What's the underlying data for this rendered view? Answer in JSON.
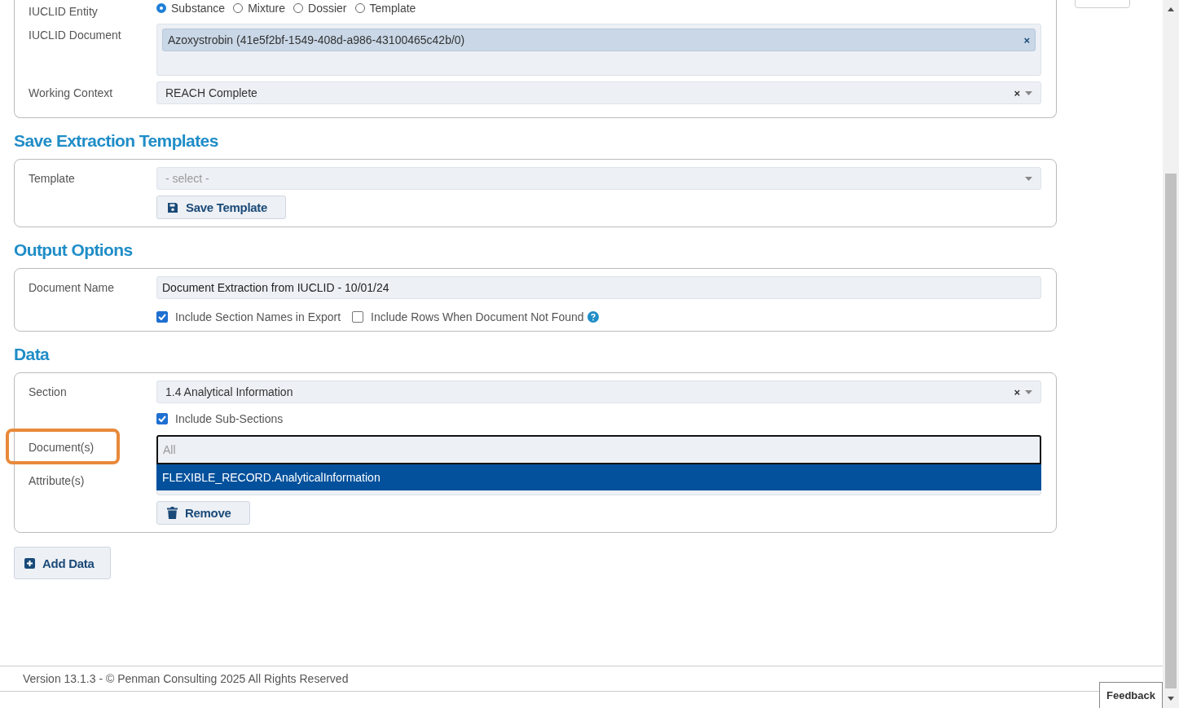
{
  "entity": {
    "label": "IUCLID Entity",
    "options": [
      {
        "label": "Substance",
        "selected": true
      },
      {
        "label": "Mixture",
        "selected": false
      },
      {
        "label": "Dossier",
        "selected": false
      },
      {
        "label": "Template",
        "selected": false
      }
    ]
  },
  "document": {
    "label": "IUCLID Document",
    "tags": [
      {
        "text": "Azoxystrobin (41e5f2bf-1549-408d-a986-43100465c42b/0)",
        "remove": "×"
      }
    ]
  },
  "working_context": {
    "label": "Working Context",
    "value": "REACH Complete",
    "clear": "×"
  },
  "templates": {
    "heading": "Save Extraction Templates",
    "label": "Template",
    "placeholder": "- select -",
    "button": "Save Template"
  },
  "output": {
    "heading": "Output Options",
    "name_label": "Document Name",
    "name_value": "Document Extraction from IUCLID - 10/01/24",
    "checks": [
      {
        "label": "Include Section Names in Export",
        "checked": true,
        "help": false
      },
      {
        "label": "Include Rows When Document Not Found",
        "checked": false,
        "help": true
      }
    ]
  },
  "data": {
    "heading": "Data",
    "section_label": "Section",
    "section_value": "1.4 Analytical Information",
    "section_clear": "×",
    "sub_sections": {
      "label": "Include Sub-Sections",
      "checked": true
    },
    "documents": {
      "label": "Document(s)",
      "highlighted": true,
      "placeholder": "All",
      "options": [
        {
          "text": "FLEXIBLE_RECORD.AnalyticalInformation",
          "selected": true
        }
      ]
    },
    "attributes_label": "Attribute(s)",
    "remove_button": "Remove"
  },
  "add_button": "Add Data",
  "footer": "Version 13.1.3 - © Penman Consulting 2025 All Rights Reserved",
  "feedback": "Feedback"
}
